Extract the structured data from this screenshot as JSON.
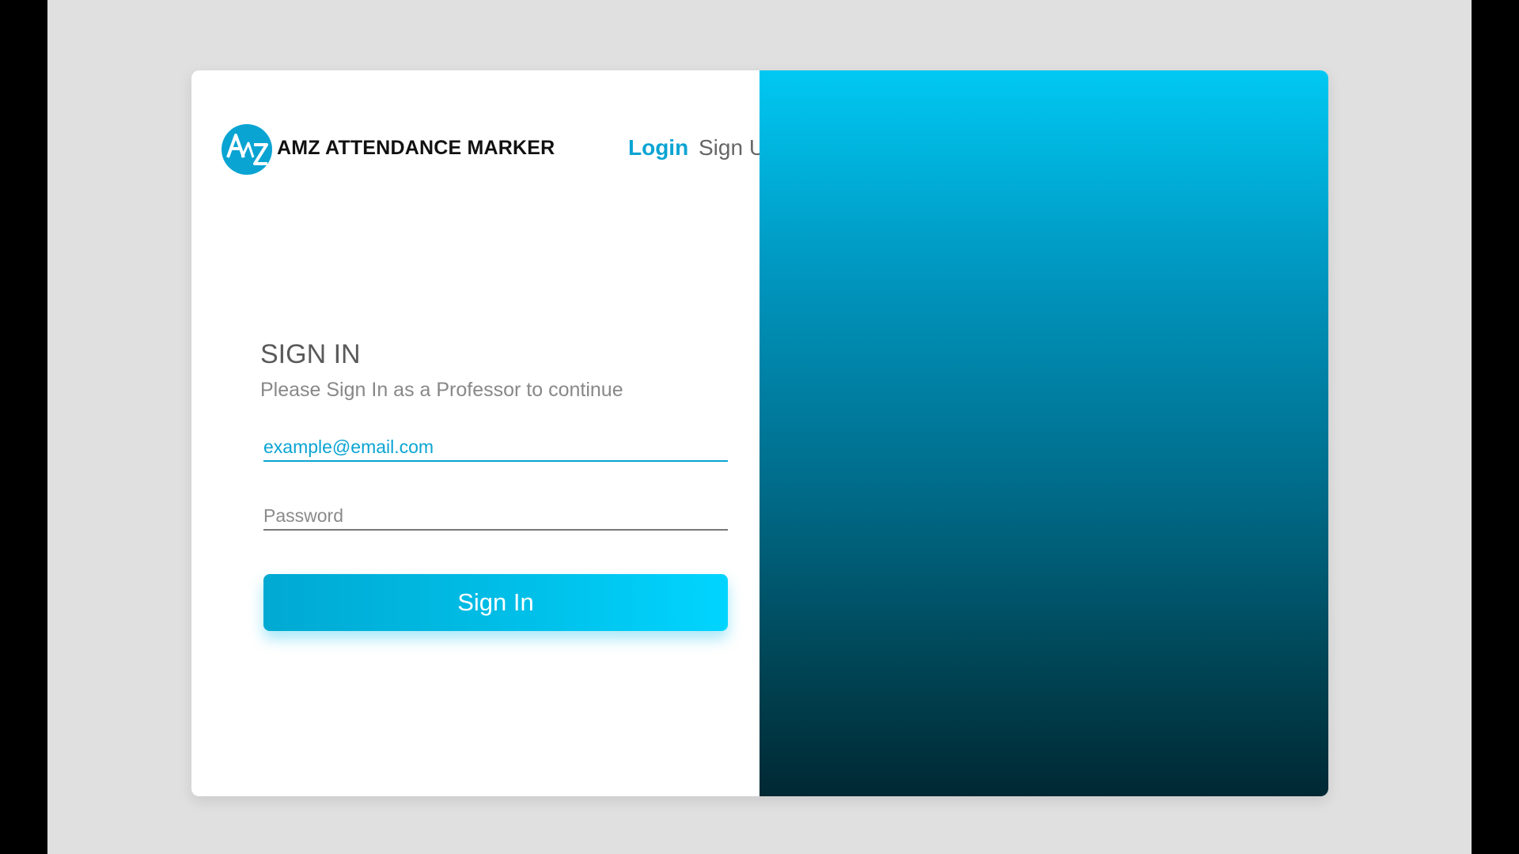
{
  "colors": {
    "accent": "#0aa4d3",
    "gradient_top": "#00c8f2",
    "gradient_bottom": "#002833",
    "text_dark": "#111111",
    "text_muted": "#888888"
  },
  "brand": {
    "logo_icon": "amz-logo-icon",
    "logo_text": "AMZ",
    "name": "AMZ ATTENDANCE MARKER"
  },
  "nav": {
    "login_label": "Login",
    "signup_label": "Sign Up"
  },
  "form": {
    "title": "SIGN IN",
    "subtitle": "Please Sign In as a Professor to continue",
    "email_value": "example@email.com",
    "email_placeholder": "",
    "password_value": "",
    "password_placeholder": "Password",
    "submit_label": "Sign In"
  }
}
